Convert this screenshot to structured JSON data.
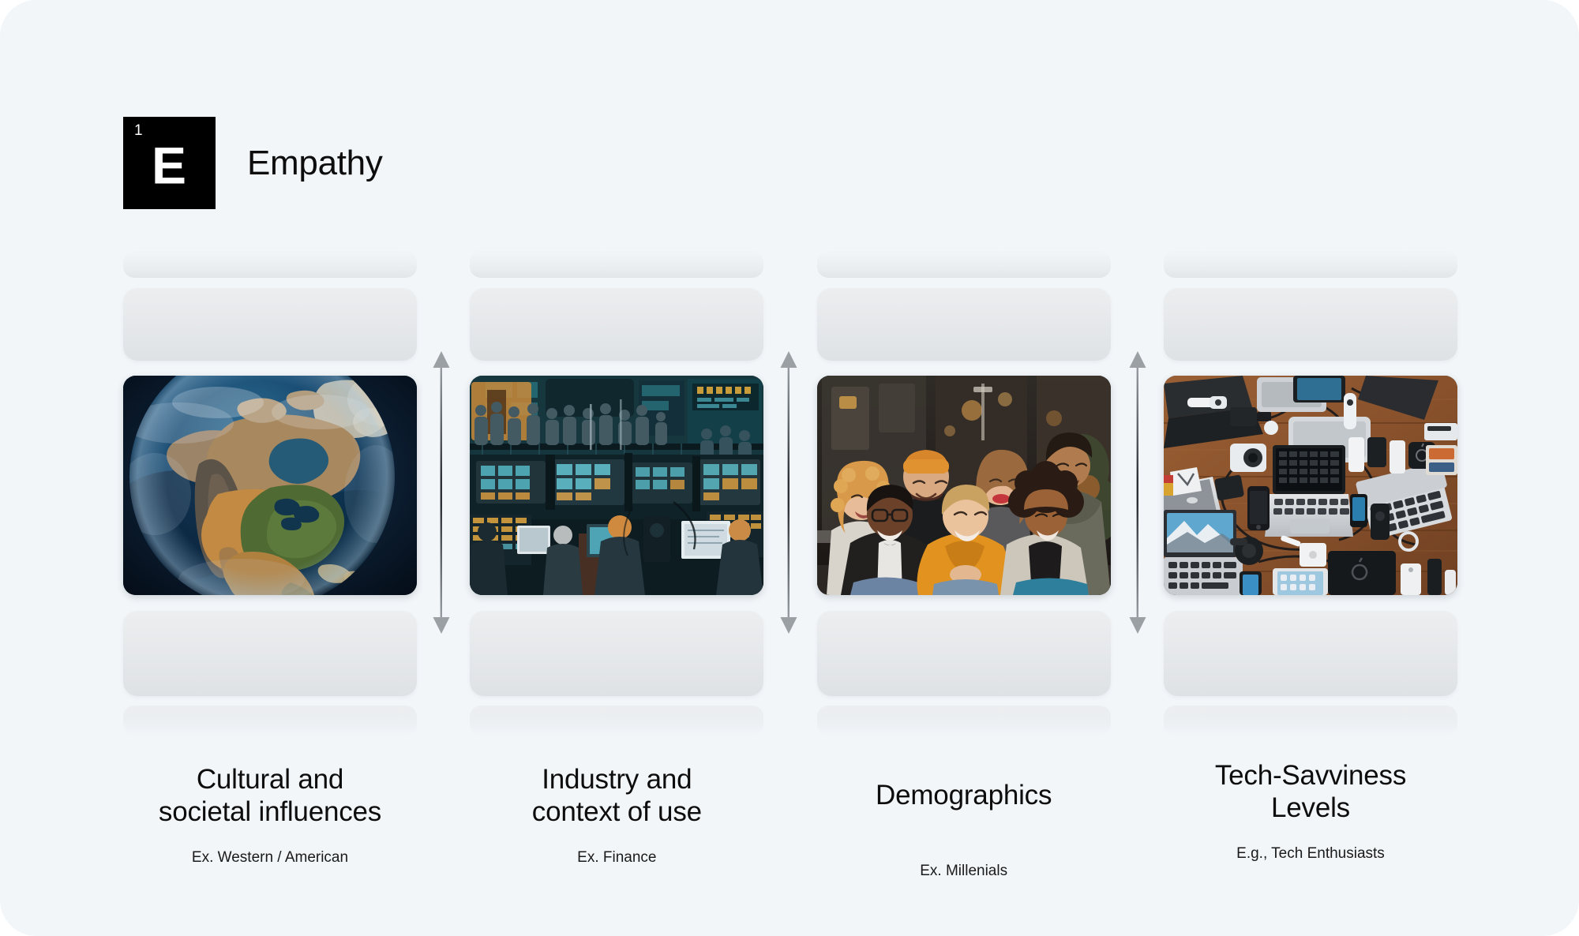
{
  "slide": {
    "background_color": "#f2f6f9",
    "badge": {
      "index": "1",
      "letter": "E",
      "background_color": "#000000",
      "text_color": "#ffffff"
    },
    "title": "Empathy"
  },
  "arrows": [
    {
      "name": "arrow-between-col1-col2",
      "direction": "double-vertical",
      "color": "#8e9398"
    },
    {
      "name": "arrow-between-col2-col3",
      "direction": "double-vertical",
      "color": "#8e9398"
    },
    {
      "name": "arrow-between-col3-col4",
      "direction": "double-vertical",
      "color": "#8e9398"
    }
  ],
  "columns": [
    {
      "id": "cultural",
      "title": "Cultural and\nsocietal influences",
      "subtitle": "Ex. Western / American",
      "image_alt": "Planet Earth seen from space showing North America"
    },
    {
      "id": "industry",
      "title": "Industry and\ncontext of use",
      "subtitle": "Ex. Finance",
      "image_alt": "Busy financial trading floor with many monitors and traders"
    },
    {
      "id": "demographics",
      "title": "Demographics",
      "subtitle": "Ex. Millenials",
      "image_alt": "Group of six smiling diverse young adults sitting outdoors"
    },
    {
      "id": "tech-savviness",
      "title": "Tech-Savviness\nLevels",
      "subtitle": "E.g., Tech Enthusiasts",
      "image_alt": "Overhead flat-lay of laptops, phones, tablets and cables on a wooden desk"
    }
  ]
}
